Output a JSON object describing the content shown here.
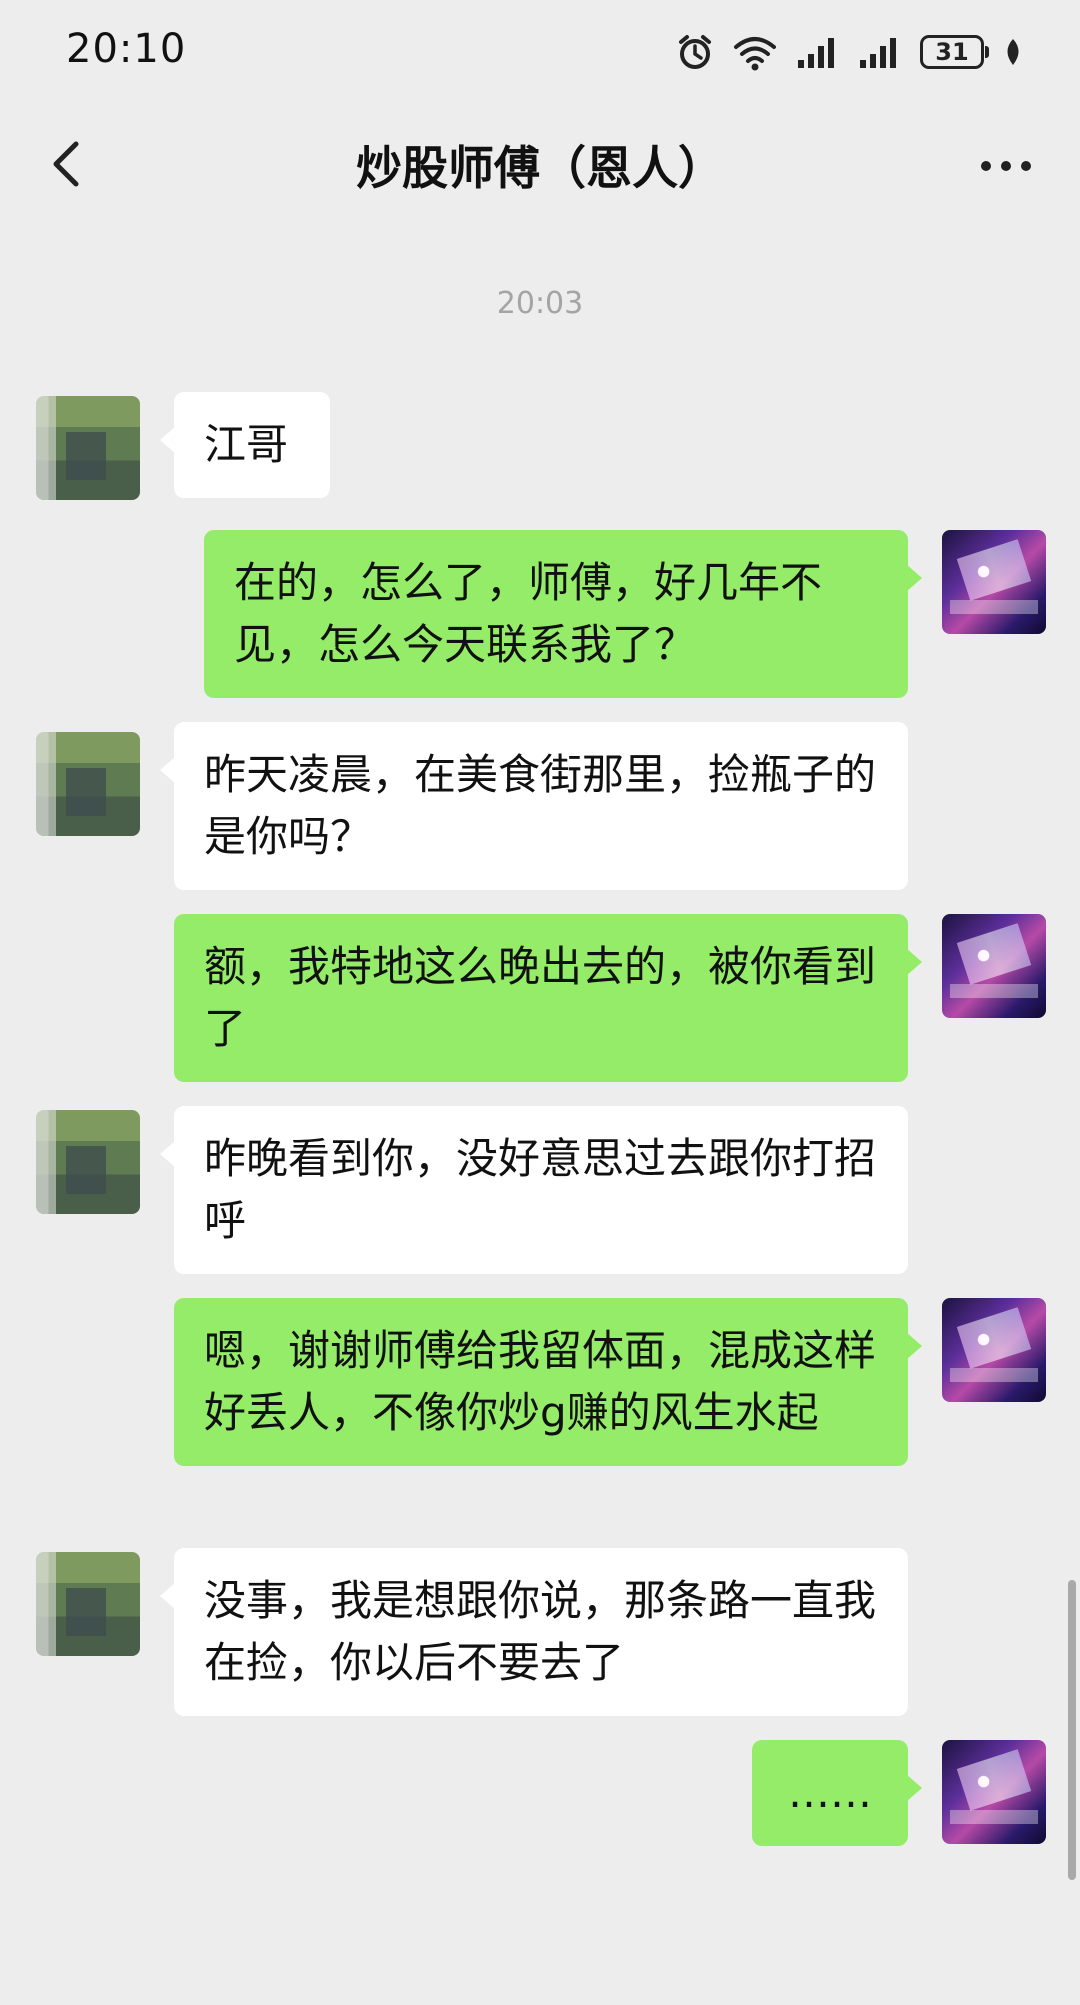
{
  "status_bar": {
    "time": "20:10",
    "battery": "31",
    "icons": [
      "alarm-icon",
      "wifi-icon",
      "signal-icon",
      "signal-icon",
      "battery-icon",
      "leaf-icon"
    ]
  },
  "header": {
    "title": "炒股师傅（恩人）",
    "back_icon": "chevron-left-icon",
    "more_icon": "more-dots-icon"
  },
  "chat": {
    "timestamp": "20:03",
    "messages": [
      {
        "from": "contact",
        "text": "江哥"
      },
      {
        "from": "me",
        "text": "在的，怎么了，师傅，好几年不见，怎么今天联系我了？"
      },
      {
        "from": "contact",
        "text": "昨天凌晨，在美食街那里，捡瓶子的是你吗？"
      },
      {
        "from": "me",
        "text": "额，我特地这么晚出去的，被你看到了"
      },
      {
        "from": "contact",
        "text": "昨晚看到你，没好意思过去跟你打招呼"
      },
      {
        "from": "me",
        "text": "嗯，谢谢师傅给我留体面，混成这样好丢人，不像你炒g赚的风生水起"
      },
      {
        "from": "contact",
        "text": "没事，我是想跟你说，那条路一直我在捡，你以后不要去了"
      },
      {
        "from": "me",
        "text": "……"
      }
    ]
  },
  "colors": {
    "background": "#ededed",
    "incoming_bubble": "#ffffff",
    "outgoing_bubble": "#95ec69"
  }
}
